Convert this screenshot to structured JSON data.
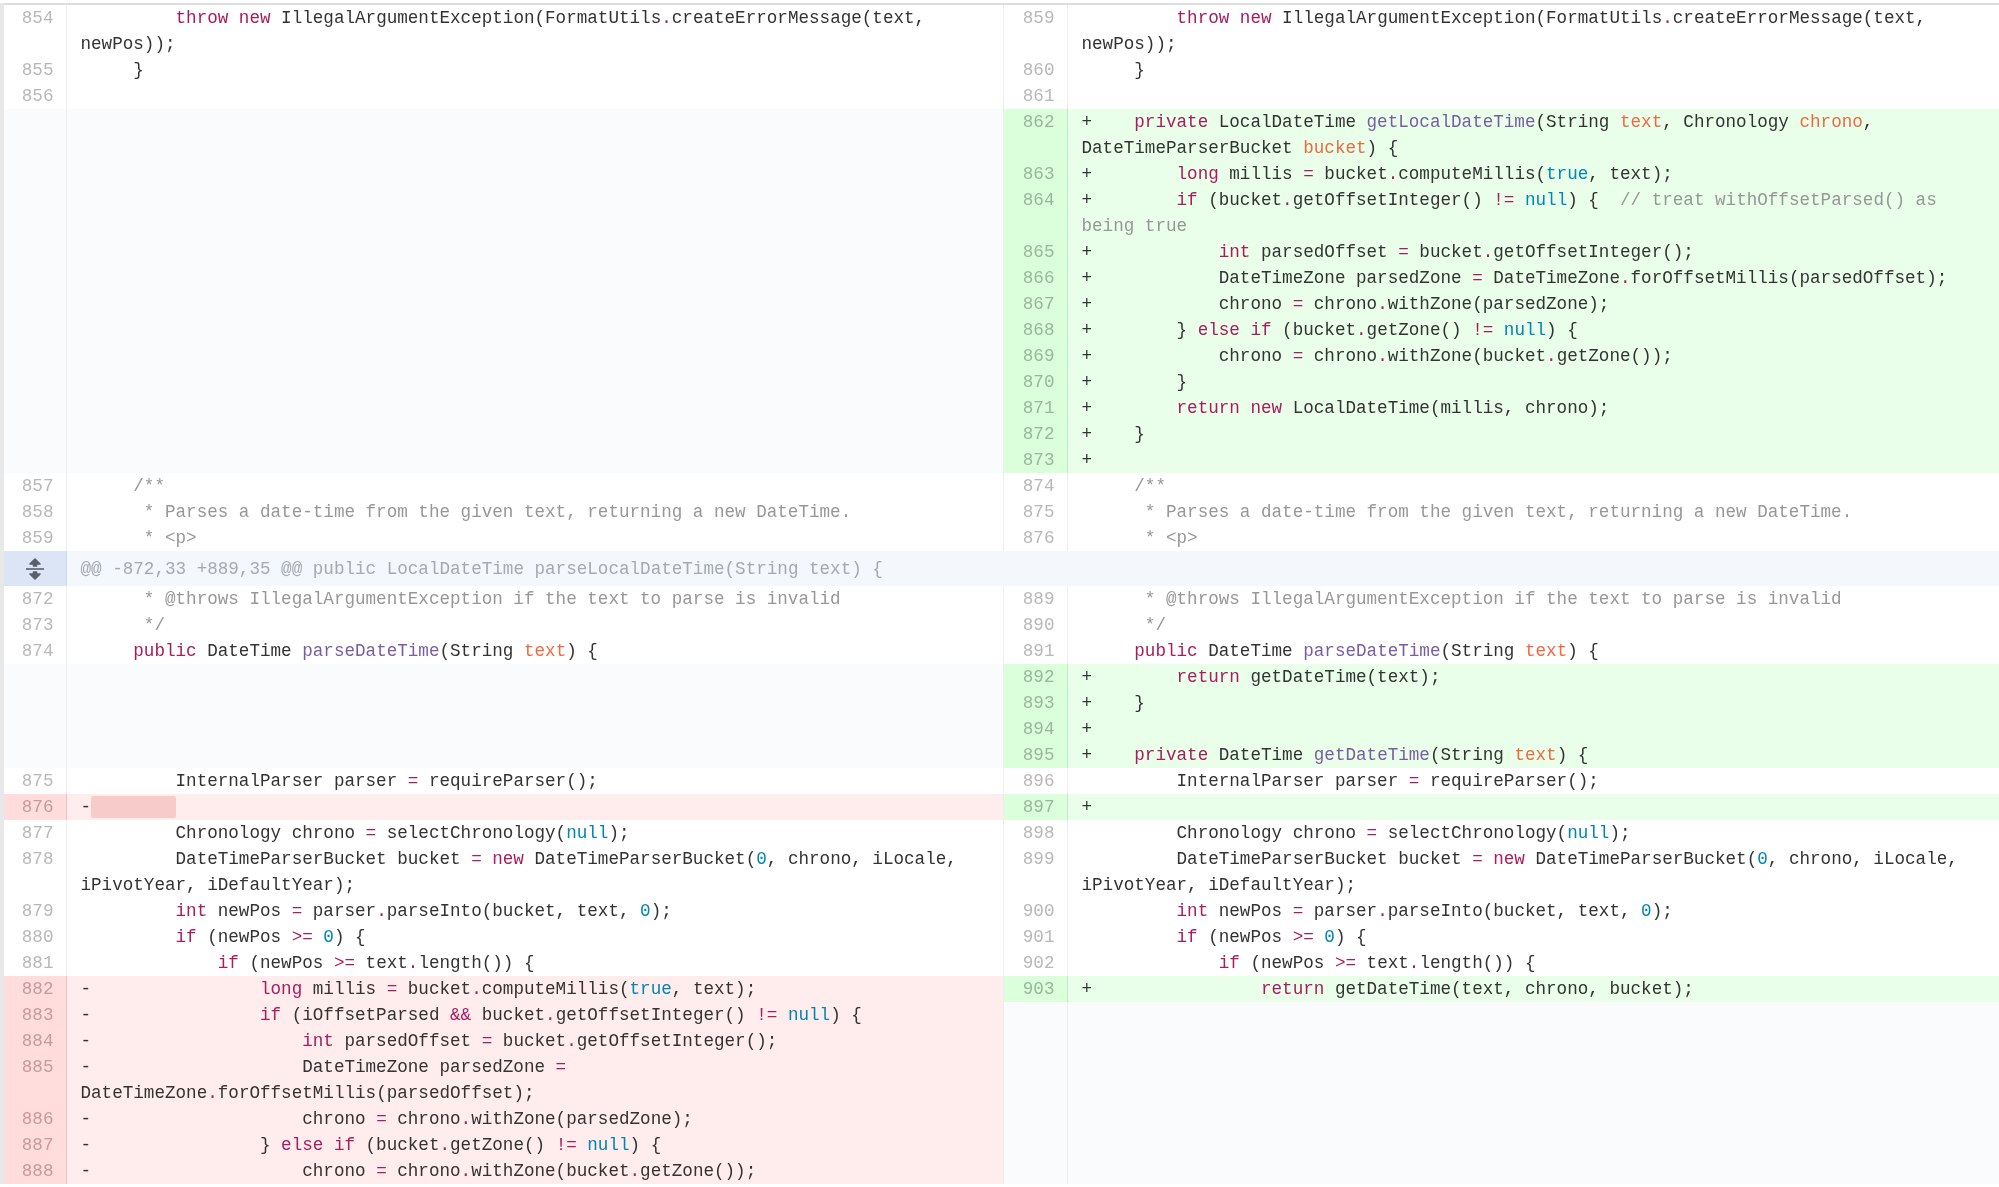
{
  "rows": [
    {
      "left": {
        "num": "854",
        "kind": "context",
        "code": [
          {
            "kind": "keyword",
            "text": "        throw new"
          },
          {
            "text": " IllegalArgumentException(FormatUtils"
          },
          {
            "kind": "keyword",
            "text": "."
          },
          {
            "text": "createErrorMessage(text, newPos));"
          }
        ]
      },
      "right": {
        "num": "859",
        "kind": "context",
        "code": [
          {
            "kind": "keyword",
            "text": "        throw new"
          },
          {
            "text": " IllegalArgumentException(FormatUtils"
          },
          {
            "kind": "keyword",
            "text": "."
          },
          {
            "text": "createErrorMessage(text, newPos));"
          }
        ]
      }
    },
    {
      "left": {
        "num": "855",
        "kind": "context",
        "code": [
          {
            "text": "    }"
          }
        ]
      },
      "right": {
        "num": "860",
        "kind": "context",
        "code": [
          {
            "text": "    }"
          }
        ]
      }
    },
    {
      "left": {
        "num": "856",
        "kind": "context"
      },
      "right": {
        "num": "861",
        "kind": "context"
      }
    },
    {
      "right": {
        "num": "862",
        "kind": "add",
        "sign": "+",
        "code": [
          {
            "kind": "keyword",
            "text": "    private"
          },
          {
            "text": " LocalDateTime "
          },
          {
            "kind": "function",
            "text": "getLocalDateTime"
          },
          {
            "text": "(String "
          },
          {
            "kind": "param",
            "text": "text"
          },
          {
            "text": ", Chronology "
          },
          {
            "kind": "param",
            "text": "chrono"
          },
          {
            "text": ", DateTimeParserBucket "
          },
          {
            "kind": "param",
            "text": "bucket"
          },
          {
            "text": ") {"
          }
        ]
      }
    },
    {
      "right": {
        "num": "863",
        "kind": "add",
        "sign": "+",
        "code": [
          {
            "kind": "keyword",
            "text": "        long"
          },
          {
            "text": " millis "
          },
          {
            "kind": "keyword",
            "text": "="
          },
          {
            "text": " bucket"
          },
          {
            "kind": "keyword",
            "text": "."
          },
          {
            "text": "computeMillis("
          },
          {
            "kind": "constant",
            "text": "true"
          },
          {
            "text": ", text);"
          }
        ]
      }
    },
    {
      "right": {
        "num": "864",
        "kind": "add",
        "sign": "+",
        "code": [
          {
            "kind": "keyword",
            "text": "        if"
          },
          {
            "text": " (bucket"
          },
          {
            "kind": "keyword",
            "text": "."
          },
          {
            "text": "getOffsetInteger() "
          },
          {
            "kind": "keyword",
            "text": "!="
          },
          {
            "kind": "constant",
            "text": " null"
          },
          {
            "text": ") {  "
          },
          {
            "kind": "comment",
            "text": "// treat withOffsetParsed() as being true"
          }
        ]
      }
    },
    {
      "right": {
        "num": "865",
        "kind": "add",
        "sign": "+",
        "code": [
          {
            "kind": "keyword",
            "text": "            int"
          },
          {
            "text": " parsedOffset "
          },
          {
            "kind": "keyword",
            "text": "="
          },
          {
            "text": " bucket"
          },
          {
            "kind": "keyword",
            "text": "."
          },
          {
            "text": "getOffsetInteger();"
          }
        ]
      }
    },
    {
      "right": {
        "num": "866",
        "kind": "add",
        "sign": "+",
        "code": [
          {
            "text": "            DateTimeZone parsedZone "
          },
          {
            "kind": "keyword",
            "text": "="
          },
          {
            "text": " DateTimeZone"
          },
          {
            "kind": "keyword",
            "text": "."
          },
          {
            "text": "forOffsetMillis(parsedOffset);"
          }
        ]
      }
    },
    {
      "right": {
        "num": "867",
        "kind": "add",
        "sign": "+",
        "code": [
          {
            "text": "            chrono "
          },
          {
            "kind": "keyword",
            "text": "="
          },
          {
            "text": " chrono"
          },
          {
            "kind": "keyword",
            "text": "."
          },
          {
            "text": "withZone(parsedZone);"
          }
        ]
      }
    },
    {
      "right": {
        "num": "868",
        "kind": "add",
        "sign": "+",
        "code": [
          {
            "text": "        } "
          },
          {
            "kind": "keyword",
            "text": "else if"
          },
          {
            "text": " (bucket"
          },
          {
            "kind": "keyword",
            "text": "."
          },
          {
            "text": "getZone() "
          },
          {
            "kind": "keyword",
            "text": "!="
          },
          {
            "kind": "constant",
            "text": " null"
          },
          {
            "text": ") {"
          }
        ]
      }
    },
    {
      "right": {
        "num": "869",
        "kind": "add",
        "sign": "+",
        "code": [
          {
            "text": "            chrono "
          },
          {
            "kind": "keyword",
            "text": "="
          },
          {
            "text": " chrono"
          },
          {
            "kind": "keyword",
            "text": "."
          },
          {
            "text": "withZone(bucket"
          },
          {
            "kind": "keyword",
            "text": "."
          },
          {
            "text": "getZone());"
          }
        ]
      }
    },
    {
      "right": {
        "num": "870",
        "kind": "add",
        "sign": "+",
        "code": [
          {
            "text": "        }"
          }
        ]
      }
    },
    {
      "right": {
        "num": "871",
        "kind": "add",
        "sign": "+",
        "code": [
          {
            "kind": "keyword",
            "text": "        return new"
          },
          {
            "text": " LocalDateTime(millis, chrono);"
          }
        ]
      }
    },
    {
      "right": {
        "num": "872",
        "kind": "add",
        "sign": "+",
        "code": [
          {
            "text": "    }"
          }
        ]
      }
    },
    {
      "right": {
        "num": "873",
        "kind": "add",
        "sign": "+"
      }
    },
    {
      "left": {
        "num": "857",
        "kind": "context",
        "code": [
          {
            "kind": "comment",
            "text": "    /**"
          }
        ]
      },
      "right": {
        "num": "874",
        "kind": "context",
        "code": [
          {
            "kind": "comment",
            "text": "    /**"
          }
        ]
      }
    },
    {
      "left": {
        "num": "858",
        "kind": "context",
        "code": [
          {
            "kind": "comment",
            "text": "     * Parses a date-time from the given text, returning a new DateTime."
          }
        ]
      },
      "right": {
        "num": "875",
        "kind": "context",
        "code": [
          {
            "kind": "comment",
            "text": "     * Parses a date-time from the given text, returning a new DateTime."
          }
        ]
      }
    },
    {
      "left": {
        "num": "859",
        "kind": "context",
        "code": [
          {
            "kind": "comment",
            "text": "     * <p>"
          }
        ]
      },
      "right": {
        "num": "876",
        "kind": "context",
        "code": [
          {
            "kind": "comment",
            "text": "     * <p>"
          }
        ]
      }
    },
    {
      "hunk": "@@ -872,33 +889,35 @@ public LocalDateTime parseLocalDateTime(String text) {"
    },
    {
      "left": {
        "num": "872",
        "kind": "context",
        "code": [
          {
            "kind": "comment",
            "text": "     * @throws IllegalArgumentException if the text to parse is invalid"
          }
        ]
      },
      "right": {
        "num": "889",
        "kind": "context",
        "code": [
          {
            "kind": "comment",
            "text": "     * @throws IllegalArgumentException if the text to parse is invalid"
          }
        ]
      }
    },
    {
      "left": {
        "num": "873",
        "kind": "context",
        "code": [
          {
            "kind": "comment",
            "text": "     */"
          }
        ]
      },
      "right": {
        "num": "890",
        "kind": "context",
        "code": [
          {
            "kind": "comment",
            "text": "     */"
          }
        ]
      }
    },
    {
      "left": {
        "num": "874",
        "kind": "context",
        "code": [
          {
            "kind": "keyword",
            "text": "    public"
          },
          {
            "text": " DateTime "
          },
          {
            "kind": "function",
            "text": "parseDateTime"
          },
          {
            "text": "(String "
          },
          {
            "kind": "param",
            "text": "text"
          },
          {
            "text": ") {"
          }
        ]
      },
      "right": {
        "num": "891",
        "kind": "context",
        "code": [
          {
            "kind": "keyword",
            "text": "    public"
          },
          {
            "text": " DateTime "
          },
          {
            "kind": "function",
            "text": "parseDateTime"
          },
          {
            "text": "(String "
          },
          {
            "kind": "param",
            "text": "text"
          },
          {
            "text": ") {"
          }
        ]
      }
    },
    {
      "right": {
        "num": "892",
        "kind": "add",
        "sign": "+",
        "code": [
          {
            "kind": "keyword",
            "text": "        return"
          },
          {
            "text": " getDateTime(text);"
          }
        ]
      }
    },
    {
      "right": {
        "num": "893",
        "kind": "add",
        "sign": "+",
        "code": [
          {
            "text": "    }"
          }
        ]
      }
    },
    {
      "right": {
        "num": "894",
        "kind": "add",
        "sign": "+"
      }
    },
    {
      "right": {
        "num": "895",
        "kind": "add",
        "sign": "+",
        "code": [
          {
            "kind": "keyword",
            "text": "    private"
          },
          {
            "text": " DateTime "
          },
          {
            "kind": "function",
            "text": "getDateTime"
          },
          {
            "text": "(String "
          },
          {
            "kind": "param",
            "text": "text"
          },
          {
            "text": ") {"
          }
        ]
      }
    },
    {
      "left": {
        "num": "875",
        "kind": "context",
        "code": [
          {
            "text": "        InternalParser parser "
          },
          {
            "kind": "keyword",
            "text": "="
          },
          {
            "text": " requireParser();"
          }
        ]
      },
      "right": {
        "num": "896",
        "kind": "context",
        "code": [
          {
            "text": "        InternalParser parser "
          },
          {
            "kind": "keyword",
            "text": "="
          },
          {
            "text": " requireParser();"
          }
        ]
      }
    },
    {
      "left": {
        "num": "876",
        "kind": "del",
        "sign": "-",
        "blank_removed": true
      },
      "right": {
        "num": "897",
        "kind": "add",
        "sign": "+"
      }
    },
    {
      "left": {
        "num": "877",
        "kind": "context",
        "code": [
          {
            "text": "        Chronology chrono "
          },
          {
            "kind": "keyword",
            "text": "="
          },
          {
            "text": " selectChronology("
          },
          {
            "kind": "constant",
            "text": "null"
          },
          {
            "text": ");"
          }
        ]
      },
      "right": {
        "num": "898",
        "kind": "context",
        "code": [
          {
            "text": "        Chronology chrono "
          },
          {
            "kind": "keyword",
            "text": "="
          },
          {
            "text": " selectChronology("
          },
          {
            "kind": "constant",
            "text": "null"
          },
          {
            "text": ");"
          }
        ]
      }
    },
    {
      "left": {
        "num": "878",
        "kind": "context",
        "code": [
          {
            "text": "        DateTimeParserBucket bucket "
          },
          {
            "kind": "keyword",
            "text": "= new"
          },
          {
            "text": " DateTimeParserBucket("
          },
          {
            "kind": "constant",
            "text": "0"
          },
          {
            "text": ", chrono, iLocale, iPivotYear, iDefaultYear);"
          }
        ]
      },
      "right": {
        "num": "899",
        "kind": "context",
        "code": [
          {
            "text": "        DateTimeParserBucket bucket "
          },
          {
            "kind": "keyword",
            "text": "= new"
          },
          {
            "text": " DateTimeParserBucket("
          },
          {
            "kind": "constant",
            "text": "0"
          },
          {
            "text": ", chrono, iLocale, iPivotYear, iDefaultYear);"
          }
        ]
      }
    },
    {
      "left": {
        "num": "879",
        "kind": "context",
        "code": [
          {
            "kind": "keyword",
            "text": "        int"
          },
          {
            "text": " newPos "
          },
          {
            "kind": "keyword",
            "text": "="
          },
          {
            "text": " parser"
          },
          {
            "kind": "keyword",
            "text": "."
          },
          {
            "text": "parseInto(bucket, text, "
          },
          {
            "kind": "constant",
            "text": "0"
          },
          {
            "text": ");"
          }
        ]
      },
      "right": {
        "num": "900",
        "kind": "context",
        "code": [
          {
            "kind": "keyword",
            "text": "        int"
          },
          {
            "text": " newPos "
          },
          {
            "kind": "keyword",
            "text": "="
          },
          {
            "text": " parser"
          },
          {
            "kind": "keyword",
            "text": "."
          },
          {
            "text": "parseInto(bucket, text, "
          },
          {
            "kind": "constant",
            "text": "0"
          },
          {
            "text": ");"
          }
        ]
      }
    },
    {
      "left": {
        "num": "880",
        "kind": "context",
        "code": [
          {
            "kind": "keyword",
            "text": "        if"
          },
          {
            "text": " (newPos "
          },
          {
            "kind": "keyword",
            "text": ">="
          },
          {
            "kind": "constant",
            "text": " 0"
          },
          {
            "text": ") {"
          }
        ]
      },
      "right": {
        "num": "901",
        "kind": "context",
        "code": [
          {
            "kind": "keyword",
            "text": "        if"
          },
          {
            "text": " (newPos "
          },
          {
            "kind": "keyword",
            "text": ">="
          },
          {
            "kind": "constant",
            "text": " 0"
          },
          {
            "text": ") {"
          }
        ]
      }
    },
    {
      "left": {
        "num": "881",
        "kind": "context",
        "code": [
          {
            "kind": "keyword",
            "text": "            if"
          },
          {
            "text": " (newPos "
          },
          {
            "kind": "keyword",
            "text": ">="
          },
          {
            "text": " text"
          },
          {
            "kind": "keyword",
            "text": "."
          },
          {
            "text": "length()) {"
          }
        ]
      },
      "right": {
        "num": "902",
        "kind": "context",
        "code": [
          {
            "kind": "keyword",
            "text": "            if"
          },
          {
            "text": " (newPos "
          },
          {
            "kind": "keyword",
            "text": ">="
          },
          {
            "text": " text"
          },
          {
            "kind": "keyword",
            "text": "."
          },
          {
            "text": "length()) {"
          }
        ]
      }
    },
    {
      "left": {
        "num": "882",
        "kind": "del",
        "sign": "-",
        "code": [
          {
            "kind": "keyword",
            "text": "                long"
          },
          {
            "text": " millis "
          },
          {
            "kind": "keyword",
            "text": "="
          },
          {
            "text": " bucket"
          },
          {
            "kind": "keyword",
            "text": "."
          },
          {
            "text": "computeMillis("
          },
          {
            "kind": "constant",
            "text": "true"
          },
          {
            "text": ", text);"
          }
        ]
      },
      "right": {
        "num": "903",
        "kind": "add",
        "sign": "+",
        "code": [
          {
            "kind": "keyword",
            "text": "                return"
          },
          {
            "text": " getDateTime(text, chrono, bucket);"
          }
        ]
      }
    },
    {
      "left": {
        "num": "883",
        "kind": "del",
        "sign": "-",
        "code": [
          {
            "kind": "keyword",
            "text": "                if"
          },
          {
            "text": " (iOffsetParsed "
          },
          {
            "kind": "keyword",
            "text": "&&"
          },
          {
            "text": " bucket"
          },
          {
            "kind": "keyword",
            "text": "."
          },
          {
            "text": "getOffsetInteger() "
          },
          {
            "kind": "keyword",
            "text": "!="
          },
          {
            "kind": "constant",
            "text": " null"
          },
          {
            "text": ") {"
          }
        ]
      }
    },
    {
      "left": {
        "num": "884",
        "kind": "del",
        "sign": "-",
        "code": [
          {
            "kind": "keyword",
            "text": "                    int"
          },
          {
            "text": " parsedOffset "
          },
          {
            "kind": "keyword",
            "text": "="
          },
          {
            "text": " bucket"
          },
          {
            "kind": "keyword",
            "text": "."
          },
          {
            "text": "getOffsetInteger();"
          }
        ]
      }
    },
    {
      "left": {
        "num": "885",
        "kind": "del",
        "sign": "-",
        "code": [
          {
            "text": "                    DateTimeZone parsedZone "
          },
          {
            "kind": "keyword",
            "text": "="
          },
          {
            "text": " DateTimeZone"
          },
          {
            "kind": "keyword",
            "text": "."
          },
          {
            "text": "forOffsetMillis(parsedOffset);"
          }
        ]
      }
    },
    {
      "left": {
        "num": "886",
        "kind": "del",
        "sign": "-",
        "code": [
          {
            "text": "                    chrono "
          },
          {
            "kind": "keyword",
            "text": "="
          },
          {
            "text": " chrono"
          },
          {
            "kind": "keyword",
            "text": "."
          },
          {
            "text": "withZone(parsedZone);"
          }
        ]
      }
    },
    {
      "left": {
        "num": "887",
        "kind": "del",
        "sign": "-",
        "code": [
          {
            "text": "                } "
          },
          {
            "kind": "keyword",
            "text": "else if"
          },
          {
            "text": " (bucket"
          },
          {
            "kind": "keyword",
            "text": "."
          },
          {
            "text": "getZone() "
          },
          {
            "kind": "keyword",
            "text": "!="
          },
          {
            "kind": "constant",
            "text": " null"
          },
          {
            "text": ") {"
          }
        ]
      }
    },
    {
      "left": {
        "num": "888",
        "kind": "del",
        "sign": "-",
        "code": [
          {
            "text": "                    chrono "
          },
          {
            "kind": "keyword",
            "text": "="
          },
          {
            "text": " chrono"
          },
          {
            "kind": "keyword",
            "text": "."
          },
          {
            "text": "withZone(bucket"
          },
          {
            "kind": "keyword",
            "text": "."
          },
          {
            "text": "getZone());"
          }
        ]
      }
    }
  ]
}
